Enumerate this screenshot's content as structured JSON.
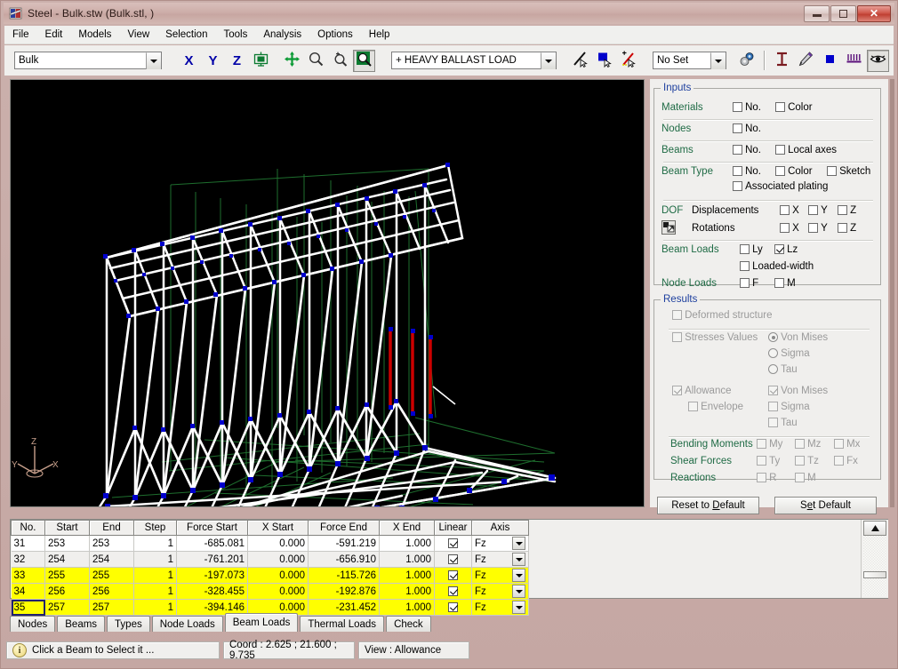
{
  "window": {
    "title": "Steel - Bulk.stw (Bulk.stl, )",
    "icon": "app-icon",
    "buttons": {
      "minimize": "minimize",
      "maximize": "maximize",
      "close": "close"
    }
  },
  "menu": {
    "items": [
      "File",
      "Edit",
      "Models",
      "View",
      "Selection",
      "Tools",
      "Analysis",
      "Options",
      "Help"
    ]
  },
  "toolbar": {
    "model_combo": {
      "value": "Bulk"
    },
    "view_x": "X",
    "view_y": "Y",
    "view_z": "Z",
    "fit_icon": "fit-to-window-icon",
    "pan_icon": "pan-icon",
    "zoom_icon": "zoom-icon",
    "zoom_in_icon": "zoom-in-icon",
    "zoom_window_icon": "zoom-window-icon",
    "load_combo": {
      "value": "+ HEAVY BALLAST LOAD"
    },
    "select_line_icon": "select-line-icon",
    "select_area_icon": "select-area-icon",
    "select_add_icon": "select-add-icon",
    "set_combo": {
      "value": "No Set"
    },
    "settings_icon": "gears-icon",
    "text_icon": "text-tool-icon",
    "pencil_icon": "pencil-icon",
    "color_icon": "color-swatch-icon",
    "loads_icon": "distributed-load-icon",
    "view_eye_icon": "eye-view-icon"
  },
  "viewport": {
    "axis_triad": {
      "x": "X",
      "y": "Y",
      "z": "Z"
    }
  },
  "inputs": {
    "legend": "Inputs",
    "rows": [
      {
        "label": "Materials",
        "checks": [
          {
            "label": "No.",
            "checked": false
          },
          {
            "label": "Color",
            "checked": false
          }
        ]
      },
      {
        "label": "Nodes",
        "checks": [
          {
            "label": "No.",
            "checked": false
          }
        ]
      },
      {
        "label": "Beams",
        "checks": [
          {
            "label": "No.",
            "checked": false
          },
          {
            "label": "Local axes",
            "checked": false
          }
        ]
      },
      {
        "label": "Beam Type",
        "checks": [
          {
            "label": "No.",
            "checked": false
          },
          {
            "label": "Color",
            "checked": false
          },
          {
            "label": "Sketch",
            "checked": false
          }
        ]
      }
    ],
    "associated_plating": {
      "label": "Associated plating",
      "checked": false
    },
    "dof": {
      "label": "DOF",
      "icon": "dof-icon",
      "displacements": {
        "label": "Displacements",
        "axes": [
          {
            "label": "X",
            "checked": false
          },
          {
            "label": "Y",
            "checked": false
          },
          {
            "label": "Z",
            "checked": false
          }
        ]
      },
      "rotations": {
        "label": "Rotations",
        "axes": [
          {
            "label": "X",
            "checked": false
          },
          {
            "label": "Y",
            "checked": false
          },
          {
            "label": "Z",
            "checked": false
          }
        ]
      }
    },
    "beam_loads": {
      "label": "Beam Loads",
      "ly": {
        "label": "Ly",
        "checked": false
      },
      "lz": {
        "label": "Lz",
        "checked": true
      },
      "loaded_width": {
        "label": "Loaded-width",
        "checked": false
      }
    },
    "node_loads": {
      "label": "Node Loads",
      "f": {
        "label": "F",
        "checked": false
      },
      "m": {
        "label": "M",
        "checked": false
      }
    }
  },
  "results": {
    "legend": "Results",
    "deformed_structure": {
      "label": "Deformed structure",
      "checked": false,
      "enabled": false
    },
    "stresses_values": {
      "label": "Stresses Values",
      "checked": false,
      "enabled": false
    },
    "stress_type": {
      "options": [
        "Von Mises",
        "Sigma",
        "Tau"
      ],
      "selected": "Von Mises"
    },
    "allowance": {
      "label": "Allowance",
      "checked": true,
      "enabled": false
    },
    "envelope": {
      "label": "Envelope",
      "checked": false,
      "enabled": false
    },
    "allowance_types": [
      {
        "label": "Von Mises",
        "checked": true
      },
      {
        "label": "Sigma",
        "checked": false
      },
      {
        "label": "Tau",
        "checked": false
      }
    ],
    "bending_moments": {
      "label": "Bending Moments",
      "items": [
        {
          "label": "My",
          "checked": false
        },
        {
          "label": "Mz",
          "checked": false
        },
        {
          "label": "Mx",
          "checked": false
        }
      ]
    },
    "shear_forces": {
      "label": "Shear Forces",
      "items": [
        {
          "label": "Ty",
          "checked": false
        },
        {
          "label": "Tz",
          "checked": false
        },
        {
          "label": "Fx",
          "checked": false
        }
      ]
    },
    "reactions": {
      "label": "Reactions",
      "items": [
        {
          "label": "R",
          "checked": false
        },
        {
          "label": "M",
          "checked": false
        }
      ]
    }
  },
  "panel_buttons": {
    "reset": {
      "pre": "Reset to ",
      "accel": "D",
      "post": "efault"
    },
    "set": {
      "pre": "S",
      "accel": "e",
      "post": "t Default"
    },
    "reset_full": "Reset to Default",
    "set_full": "Set Default"
  },
  "table": {
    "columns": [
      "No.",
      "Start",
      "End",
      "Step",
      "Force Start",
      "X Start",
      "Force End",
      "X End",
      "Linear",
      "Axis"
    ],
    "rows": [
      {
        "no": "31",
        "start": "253",
        "end": "253",
        "step": "1",
        "force_start": "-685.081",
        "x_start": "0.000",
        "force_end": "-591.219",
        "x_end": "1.000",
        "linear": true,
        "axis": "Fz",
        "highlight": false,
        "selected": false
      },
      {
        "no": "32",
        "start": "254",
        "end": "254",
        "step": "1",
        "force_start": "-761.201",
        "x_start": "0.000",
        "force_end": "-656.910",
        "x_end": "1.000",
        "linear": true,
        "axis": "Fz",
        "highlight": false,
        "selected": false
      },
      {
        "no": "33",
        "start": "255",
        "end": "255",
        "step": "1",
        "force_start": "-197.073",
        "x_start": "0.000",
        "force_end": "-115.726",
        "x_end": "1.000",
        "linear": true,
        "axis": "Fz",
        "highlight": true,
        "selected": false
      },
      {
        "no": "34",
        "start": "256",
        "end": "256",
        "step": "1",
        "force_start": "-328.455",
        "x_start": "0.000",
        "force_end": "-192.876",
        "x_end": "1.000",
        "linear": true,
        "axis": "Fz",
        "highlight": true,
        "selected": false
      },
      {
        "no": "35",
        "start": "257",
        "end": "257",
        "step": "1",
        "force_start": "-394.146",
        "x_start": "0.000",
        "force_end": "-231.452",
        "x_end": "1.000",
        "linear": true,
        "axis": "Fz",
        "highlight": true,
        "selected": true
      }
    ]
  },
  "tabs": {
    "items": [
      "Nodes",
      "Beams",
      "Types",
      "Node Loads",
      "Beam Loads",
      "Thermal Loads",
      "Check"
    ],
    "active": "Beam Loads"
  },
  "statusbar": {
    "hint": "Click a Beam to Select it ...",
    "coord": "Coord : 2.625 ; 21.600 ; 9.735",
    "view": "View : Allowance"
  },
  "colors": {
    "accent_blue": "#1d3f9e",
    "label_green": "#1f6b45",
    "highlight_yellow": "#ffff00",
    "node_blue": "#0000c8",
    "beam_white": "#ffffff",
    "plating_green": "#1e6e2e",
    "selected_red": "#cc0000",
    "axis_tan": "#c8a08c"
  }
}
